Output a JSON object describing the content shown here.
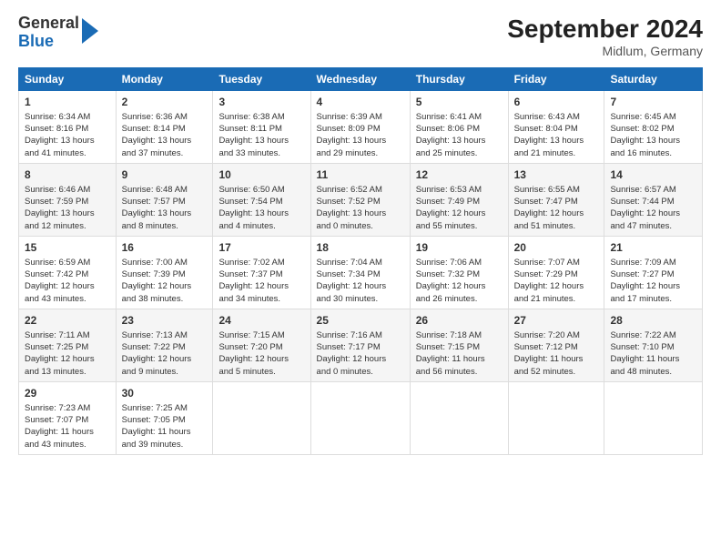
{
  "header": {
    "logo_general": "General",
    "logo_blue": "Blue",
    "title": "September 2024",
    "subtitle": "Midlum, Germany"
  },
  "columns": [
    "Sunday",
    "Monday",
    "Tuesday",
    "Wednesday",
    "Thursday",
    "Friday",
    "Saturday"
  ],
  "weeks": [
    [
      {
        "day": "1",
        "info": "Sunrise: 6:34 AM\nSunset: 8:16 PM\nDaylight: 13 hours\nand 41 minutes."
      },
      {
        "day": "2",
        "info": "Sunrise: 6:36 AM\nSunset: 8:14 PM\nDaylight: 13 hours\nand 37 minutes."
      },
      {
        "day": "3",
        "info": "Sunrise: 6:38 AM\nSunset: 8:11 PM\nDaylight: 13 hours\nand 33 minutes."
      },
      {
        "day": "4",
        "info": "Sunrise: 6:39 AM\nSunset: 8:09 PM\nDaylight: 13 hours\nand 29 minutes."
      },
      {
        "day": "5",
        "info": "Sunrise: 6:41 AM\nSunset: 8:06 PM\nDaylight: 13 hours\nand 25 minutes."
      },
      {
        "day": "6",
        "info": "Sunrise: 6:43 AM\nSunset: 8:04 PM\nDaylight: 13 hours\nand 21 minutes."
      },
      {
        "day": "7",
        "info": "Sunrise: 6:45 AM\nSunset: 8:02 PM\nDaylight: 13 hours\nand 16 minutes."
      }
    ],
    [
      {
        "day": "8",
        "info": "Sunrise: 6:46 AM\nSunset: 7:59 PM\nDaylight: 13 hours\nand 12 minutes."
      },
      {
        "day": "9",
        "info": "Sunrise: 6:48 AM\nSunset: 7:57 PM\nDaylight: 13 hours\nand 8 minutes."
      },
      {
        "day": "10",
        "info": "Sunrise: 6:50 AM\nSunset: 7:54 PM\nDaylight: 13 hours\nand 4 minutes."
      },
      {
        "day": "11",
        "info": "Sunrise: 6:52 AM\nSunset: 7:52 PM\nDaylight: 13 hours\nand 0 minutes."
      },
      {
        "day": "12",
        "info": "Sunrise: 6:53 AM\nSunset: 7:49 PM\nDaylight: 12 hours\nand 55 minutes."
      },
      {
        "day": "13",
        "info": "Sunrise: 6:55 AM\nSunset: 7:47 PM\nDaylight: 12 hours\nand 51 minutes."
      },
      {
        "day": "14",
        "info": "Sunrise: 6:57 AM\nSunset: 7:44 PM\nDaylight: 12 hours\nand 47 minutes."
      }
    ],
    [
      {
        "day": "15",
        "info": "Sunrise: 6:59 AM\nSunset: 7:42 PM\nDaylight: 12 hours\nand 43 minutes."
      },
      {
        "day": "16",
        "info": "Sunrise: 7:00 AM\nSunset: 7:39 PM\nDaylight: 12 hours\nand 38 minutes."
      },
      {
        "day": "17",
        "info": "Sunrise: 7:02 AM\nSunset: 7:37 PM\nDaylight: 12 hours\nand 34 minutes."
      },
      {
        "day": "18",
        "info": "Sunrise: 7:04 AM\nSunset: 7:34 PM\nDaylight: 12 hours\nand 30 minutes."
      },
      {
        "day": "19",
        "info": "Sunrise: 7:06 AM\nSunset: 7:32 PM\nDaylight: 12 hours\nand 26 minutes."
      },
      {
        "day": "20",
        "info": "Sunrise: 7:07 AM\nSunset: 7:29 PM\nDaylight: 12 hours\nand 21 minutes."
      },
      {
        "day": "21",
        "info": "Sunrise: 7:09 AM\nSunset: 7:27 PM\nDaylight: 12 hours\nand 17 minutes."
      }
    ],
    [
      {
        "day": "22",
        "info": "Sunrise: 7:11 AM\nSunset: 7:25 PM\nDaylight: 12 hours\nand 13 minutes."
      },
      {
        "day": "23",
        "info": "Sunrise: 7:13 AM\nSunset: 7:22 PM\nDaylight: 12 hours\nand 9 minutes."
      },
      {
        "day": "24",
        "info": "Sunrise: 7:15 AM\nSunset: 7:20 PM\nDaylight: 12 hours\nand 5 minutes."
      },
      {
        "day": "25",
        "info": "Sunrise: 7:16 AM\nSunset: 7:17 PM\nDaylight: 12 hours\nand 0 minutes."
      },
      {
        "day": "26",
        "info": "Sunrise: 7:18 AM\nSunset: 7:15 PM\nDaylight: 11 hours\nand 56 minutes."
      },
      {
        "day": "27",
        "info": "Sunrise: 7:20 AM\nSunset: 7:12 PM\nDaylight: 11 hours\nand 52 minutes."
      },
      {
        "day": "28",
        "info": "Sunrise: 7:22 AM\nSunset: 7:10 PM\nDaylight: 11 hours\nand 48 minutes."
      }
    ],
    [
      {
        "day": "29",
        "info": "Sunrise: 7:23 AM\nSunset: 7:07 PM\nDaylight: 11 hours\nand 43 minutes."
      },
      {
        "day": "30",
        "info": "Sunrise: 7:25 AM\nSunset: 7:05 PM\nDaylight: 11 hours\nand 39 minutes."
      },
      {
        "day": "",
        "info": ""
      },
      {
        "day": "",
        "info": ""
      },
      {
        "day": "",
        "info": ""
      },
      {
        "day": "",
        "info": ""
      },
      {
        "day": "",
        "info": ""
      }
    ]
  ]
}
